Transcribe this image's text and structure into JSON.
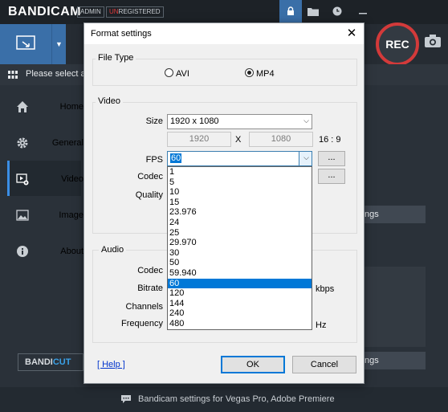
{
  "app": {
    "logo_bandi": "BANDI",
    "logo_cam": "CAM",
    "badge_admin": "ADMIN",
    "badge_un": "UN",
    "badge_registered": "REGISTERED",
    "rec_label": "REC",
    "subheader_text": "Please select a",
    "footer_text": "Bandicam settings for Vegas Pro, Adobe Premiere",
    "bandicut_bandi": "BANDI",
    "bandicut_cut": "CUT",
    "right_btn_1": "ngs",
    "right_btn_2": "ngs"
  },
  "sidebar": {
    "items": [
      {
        "label": "Home",
        "icon": "home-icon"
      },
      {
        "label": "General",
        "icon": "gear-icon"
      },
      {
        "label": "Video",
        "icon": "video-gear-icon",
        "active": true
      },
      {
        "label": "Image",
        "icon": "image-icon"
      },
      {
        "label": "About",
        "icon": "info-icon"
      }
    ]
  },
  "dialog": {
    "title": "Format settings",
    "file_type": {
      "legend": "File Type",
      "options": [
        "AVI",
        "MP4"
      ],
      "selected": "MP4"
    },
    "video": {
      "legend": "Video",
      "size_label": "Size",
      "size_value": "1920 x 1080",
      "width": "1920",
      "x_sep": "X",
      "height": "1080",
      "ratio": "16 : 9",
      "fps_label": "FPS",
      "fps_value": "60",
      "codec_label": "Codec",
      "quality_label": "Quality",
      "dots": "..."
    },
    "fps_options": [
      "1",
      "5",
      "10",
      "15",
      "23.976",
      "24",
      "25",
      "29.970",
      "30",
      "50",
      "59.940",
      "60",
      "120",
      "144",
      "240",
      "480"
    ],
    "fps_selected_index": 11,
    "audio": {
      "legend": "Audio",
      "codec_label": "Codec",
      "bitrate_label": "Bitrate",
      "bitrate_unit": "kbps",
      "channels_label": "Channels",
      "frequency_label": "Frequency",
      "frequency_unit": "Hz"
    },
    "help_label": "[ Help ]",
    "ok_label": "OK",
    "cancel_label": "Cancel"
  },
  "colors": {
    "accent": "#3a6fa8",
    "rec_ring": "#d33a3a",
    "selection": "#0078d7",
    "app_bg": "#2a3139"
  }
}
